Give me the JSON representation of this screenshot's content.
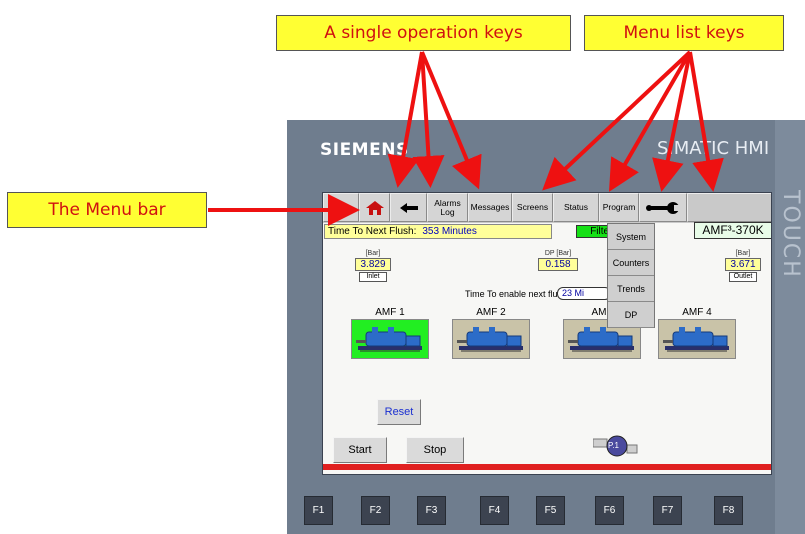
{
  "callouts": {
    "single_operation": "A single operation keys",
    "menu_list": "Menu list keys",
    "menu_bar": "The Menu bar"
  },
  "device": {
    "brand": "SIEMENS",
    "model": "SIMATIC HMI",
    "side_text": "TOUCH",
    "function_keys": [
      "F1",
      "F2",
      "F3",
      "F4",
      "F5",
      "F6",
      "F7",
      "F8"
    ]
  },
  "menubar": {
    "key_icon": "key-icon",
    "home_icon": "home-icon",
    "back_icon": "left-arrow-icon",
    "alarms_log": "Alarms Log",
    "messages": "Messages",
    "screens": "Screens",
    "status": "Status",
    "program": "Program",
    "tools_icon": "wrench-icon"
  },
  "status_dropdown": [
    "System",
    "Counters",
    "Trends",
    "DP"
  ],
  "hmi": {
    "flush_label": "Time To Next Flush:",
    "flush_value": "353 Minutes",
    "filtering": "Filtering",
    "model_tag": "AMF³-370K",
    "inlet": {
      "unit": "[Bar]",
      "value": "3.829",
      "label": "Inlet"
    },
    "dp": {
      "unit": "DP  [Bar]",
      "value": "0.158"
    },
    "outlet": {
      "unit": "[Bar]",
      "value": "3.671",
      "label": "Outlet"
    },
    "enable_label": "Time To enable next flush:",
    "enable_value": "23 Mi",
    "filters": [
      {
        "name": "AMF 1",
        "state_color": "#22ee22"
      },
      {
        "name": "AMF 2",
        "state_color": "#c9c3a8"
      },
      {
        "name": "AMF",
        "state_color": "#c9c3a8"
      },
      {
        "name": "AMF 4",
        "state_color": "#c9c3a8"
      }
    ],
    "reset": "Reset",
    "start": "Start",
    "stop": "Stop",
    "pump": "P.1"
  },
  "colors": {
    "callout_bg": "#ffff33",
    "callout_text": "#d01010",
    "arrow": "#ee1111"
  }
}
